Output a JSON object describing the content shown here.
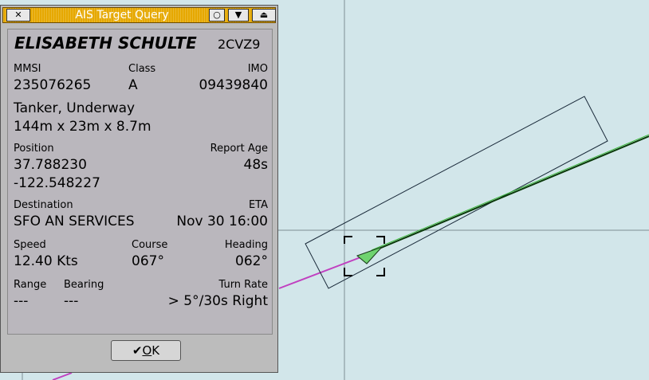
{
  "dialog": {
    "title": "AIS Target Query",
    "buttons": {
      "close": "✕",
      "circle": "○",
      "shade": "▼",
      "eject": "⏏"
    },
    "vessel_name": "ELISABETH SCHULTE",
    "callsign": "2CVZ9",
    "mmsi_label": "MMSI",
    "mmsi": "235076265",
    "class_label": "Class",
    "class": "A",
    "imo_label": "IMO",
    "imo": "09439840",
    "type_status": "Tanker, Underway",
    "dimensions": "144m x 23m x 8.7m",
    "position_label": "Position",
    "lat": "37.788230",
    "lon": "-122.548227",
    "report_age_label": "Report Age",
    "report_age": "48s",
    "destination_label": "Destination",
    "destination": "SFO AN SERVICES",
    "eta_label": "ETA",
    "eta": "Nov 30 16:00",
    "speed_label": "Speed",
    "speed": "12.40 Kts",
    "course_label": "Course",
    "course": "067°",
    "heading_label": "Heading",
    "heading": "062°",
    "range_label": "Range",
    "range": "---",
    "bearing_label": "Bearing",
    "bearing": "---",
    "turn_rate_label": "Turn Rate",
    "turn_rate": "> 5°/30s Right",
    "ok_check": "✔",
    "ok_hotkey": "O",
    "ok_rest": "K"
  },
  "colors": {
    "chart_background": "#d2e6ea",
    "target_fill": "#6fd36f",
    "heading_line": "#1a7a1a",
    "track_line": "#c040c0",
    "titlebar": "#e6a800"
  }
}
